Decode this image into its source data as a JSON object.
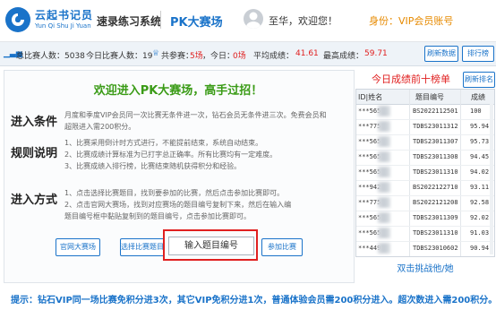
{
  "header": {
    "logo_cn": "云起书记员",
    "logo_en": "Yun Qi Shu Ji Yuan",
    "system_name": "速录练习系统",
    "page_title": "PK大赛场",
    "welcome": "至华，欢迎您！",
    "identity": "身份：VIP会员账号"
  },
  "stats": {
    "total_participants": "总比赛人数：5038",
    "today_participants": "今日比赛人数：19",
    "total_count_label": "共参赛：",
    "total_count": "5场",
    "today_count_label": "，今日：",
    "today_count": "0场",
    "avg_label": "平均成绩：",
    "avg_value": "41.61",
    "best_label": "最高成绩：",
    "best_value": "59.71",
    "refresh_btn": "刷新数据",
    "rank_btn": "排行榜"
  },
  "main": {
    "title": "欢迎进入PK大赛场，高手过招！",
    "entry_label": "进入条件",
    "entry_text": [
      "月度和季度VIP会员同一次比赛无条件进一次，钻石会员无条件进三次。免费会员和",
      "超限进入需200积分。"
    ],
    "rules_label": "规则说明",
    "rules_text": [
      "1、比赛采用倒计时方式进行，不能提前结束，系统自动结束。",
      "2、比赛成绩计算标准为已打字总正确率。所有比赛均有一定难度。",
      "3、比赛成绩入排行榜，比赛结束随机获得积分和经验。"
    ],
    "mode_label": "进入方式",
    "mode_text": [
      "1、点击选择比赛题目，找到要参加的比赛，然后点击参加比赛即可。",
      "2、点击官网大赛场，找到对应赛场的题目编号复制下来，然后在输入编",
      "题目编号框中黏贴复制到的题目编号，点击参加比赛即可。"
    ],
    "btn_official": "官网大赛场",
    "btn_select": "选择比赛题目",
    "input_placeholder": "输入题目编号",
    "btn_join": "参加比赛"
  },
  "leaderboard": {
    "title": "今日成绩前十榜单",
    "refresh": "刷新排名",
    "headers": [
      "ID|姓名",
      "题目编号",
      "成绩"
    ],
    "rows": [
      {
        "id": "***5653",
        "code": "BS2022112501",
        "score": "100"
      },
      {
        "id": "***7751",
        "code": "TDBS23011312",
        "score": "95.94"
      },
      {
        "id": "***5653",
        "code": "TDBS23011307",
        "score": "95.73"
      },
      {
        "id": "***5653",
        "code": "TDBS23011308",
        "score": "94.45"
      },
      {
        "id": "***5653",
        "code": "TDBS23011310",
        "score": "94.02"
      },
      {
        "id": "***9428",
        "code": "BS2022122710",
        "score": "93.11"
      },
      {
        "id": "***7751",
        "code": "BS2022121208",
        "score": "92.58"
      },
      {
        "id": "***5653",
        "code": "TDBS23011309",
        "score": "92.02"
      },
      {
        "id": "***5653",
        "code": "TDBS23011310",
        "score": "91.03"
      },
      {
        "id": "***4490",
        "code": "TDBS23010602",
        "score": "90.94"
      }
    ],
    "double_click": "双击挑战他/她"
  },
  "tip": "提示：钻石VIP同一场比赛免积分进3次，其它VIP免积分进1次，普通体验会员需200积分进入。超次数进入需200积分。",
  "colors": {
    "accent": "#1a73c9",
    "highlight": "#e02020",
    "title_green": "#3a9b16"
  }
}
